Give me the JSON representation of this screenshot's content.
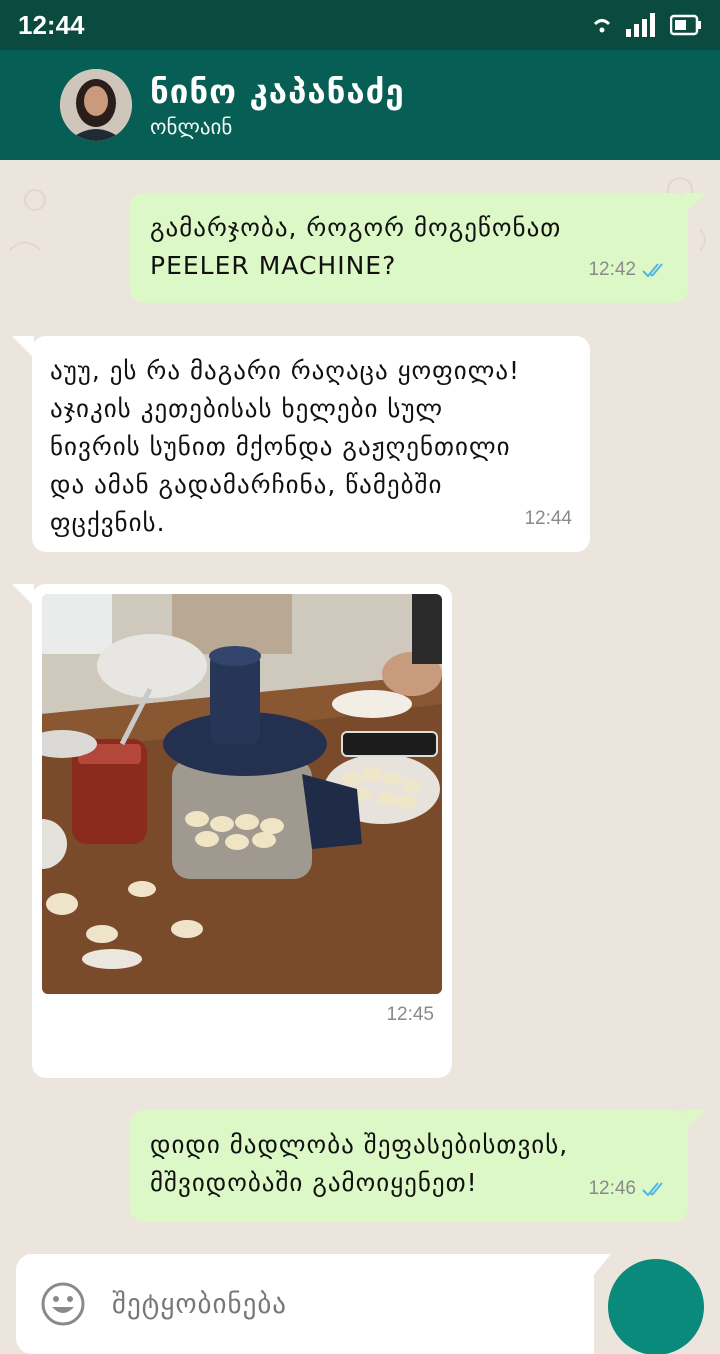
{
  "status_bar": {
    "time": "12:44"
  },
  "contact": {
    "name": "ნინო კაპანაძე",
    "status": "ონლაინ"
  },
  "messages": [
    {
      "direction": "out",
      "text": "გამარჯობა, როგორ მოგეწონათ\nPEELER MACHINE?",
      "time": "12:42",
      "read": true
    },
    {
      "direction": "in",
      "text": "აუუ, ეს რა მაგარი რაღაცა ყოფილა!\nაჯიკის კეთებისას ხელები სულ\nნივრის სუნით მქონდა გაჟღენთილი\nდა ამან გადამარჩინა, წამებში\nფცქვნის.",
      "time": "12:44"
    },
    {
      "direction": "in",
      "type": "image",
      "time": "12:45"
    },
    {
      "direction": "out",
      "text": "დიდი მადლობა შეფასებისთვის,\nმშვიდობაში გამოიყენეთ!",
      "time": "12:46",
      "read": true
    }
  ],
  "input": {
    "placeholder": "შეტყობინება"
  },
  "colors": {
    "header": "#075e54",
    "status_bar": "#0b4a3f",
    "outgoing": "#dcf8c6",
    "incoming": "#ffffff",
    "read_ticks": "#4fb6ec",
    "send_button": "#0a8a7a"
  }
}
